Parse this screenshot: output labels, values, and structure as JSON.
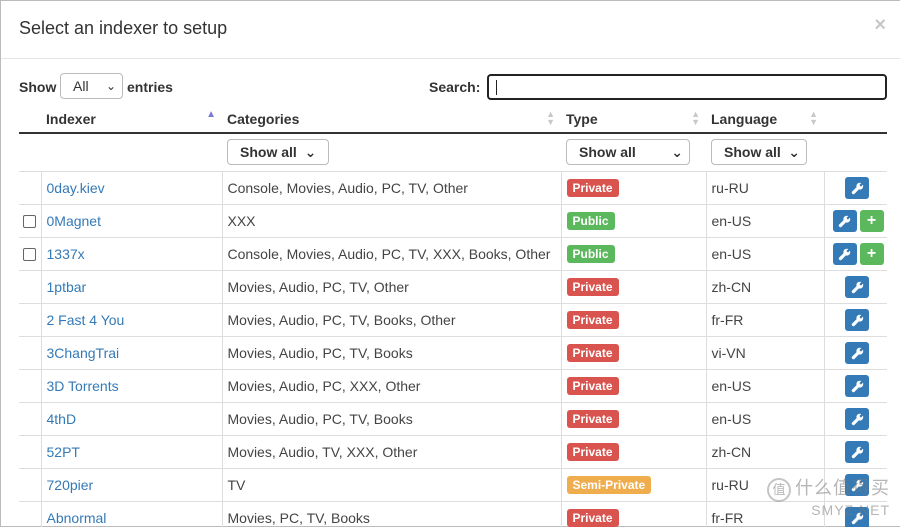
{
  "modal": {
    "title": "Select an indexer to setup",
    "close": "×"
  },
  "controls": {
    "show_label": "Show",
    "entries_value": "All",
    "entries_label": "entries",
    "search_label": "Search:",
    "search_value": ""
  },
  "columns": {
    "indexer": "Indexer",
    "categories": "Categories",
    "type": "Type",
    "language": "Language"
  },
  "filters": {
    "categories": "Show all",
    "type": "Show all",
    "language": "Show all"
  },
  "rows": [
    {
      "name": "0day.kiev",
      "categories": "Console, Movies, Audio, PC, TV, Other",
      "type": "Private",
      "language": "ru-RU",
      "checkbox": false,
      "add": false
    },
    {
      "name": "0Magnet",
      "categories": "XXX",
      "type": "Public",
      "language": "en-US",
      "checkbox": true,
      "add": true
    },
    {
      "name": "1337x",
      "categories": "Console, Movies, Audio, PC, TV, XXX, Books, Other",
      "type": "Public",
      "language": "en-US",
      "checkbox": true,
      "add": true
    },
    {
      "name": "1ptbar",
      "categories": "Movies, Audio, PC, TV, Other",
      "type": "Private",
      "language": "zh-CN",
      "checkbox": false,
      "add": false
    },
    {
      "name": "2 Fast 4 You",
      "categories": "Movies, Audio, PC, TV, Books, Other",
      "type": "Private",
      "language": "fr-FR",
      "checkbox": false,
      "add": false
    },
    {
      "name": "3ChangTrai",
      "categories": "Movies, Audio, PC, TV, Books",
      "type": "Private",
      "language": "vi-VN",
      "checkbox": false,
      "add": false
    },
    {
      "name": "3D Torrents",
      "categories": "Movies, Audio, PC, XXX, Other",
      "type": "Private",
      "language": "en-US",
      "checkbox": false,
      "add": false
    },
    {
      "name": "4thD",
      "categories": "Movies, Audio, PC, TV, Books",
      "type": "Private",
      "language": "en-US",
      "checkbox": false,
      "add": false
    },
    {
      "name": "52PT",
      "categories": "Movies, Audio, TV, XXX, Other",
      "type": "Private",
      "language": "zh-CN",
      "checkbox": false,
      "add": false
    },
    {
      "name": "720pier",
      "categories": "TV",
      "type": "Semi-Private",
      "language": "ru-RU",
      "checkbox": false,
      "add": false
    },
    {
      "name": "Abnormal",
      "categories": "Movies, PC, TV, Books",
      "type": "Private",
      "language": "fr-FR",
      "checkbox": false,
      "add": false
    }
  ],
  "icons": {
    "wrench": "wrench-icon",
    "add": "plus-icon",
    "chevron": "chevron-down-icon"
  },
  "colors": {
    "private": "#d9534f",
    "public": "#5cb85c",
    "semi_private": "#f0ad4e",
    "link": "#337ab7",
    "button": "#337ab7"
  },
  "watermark": {
    "circle": "值",
    "top": "什么值得买",
    "bottom": "SMYZ.NET"
  }
}
